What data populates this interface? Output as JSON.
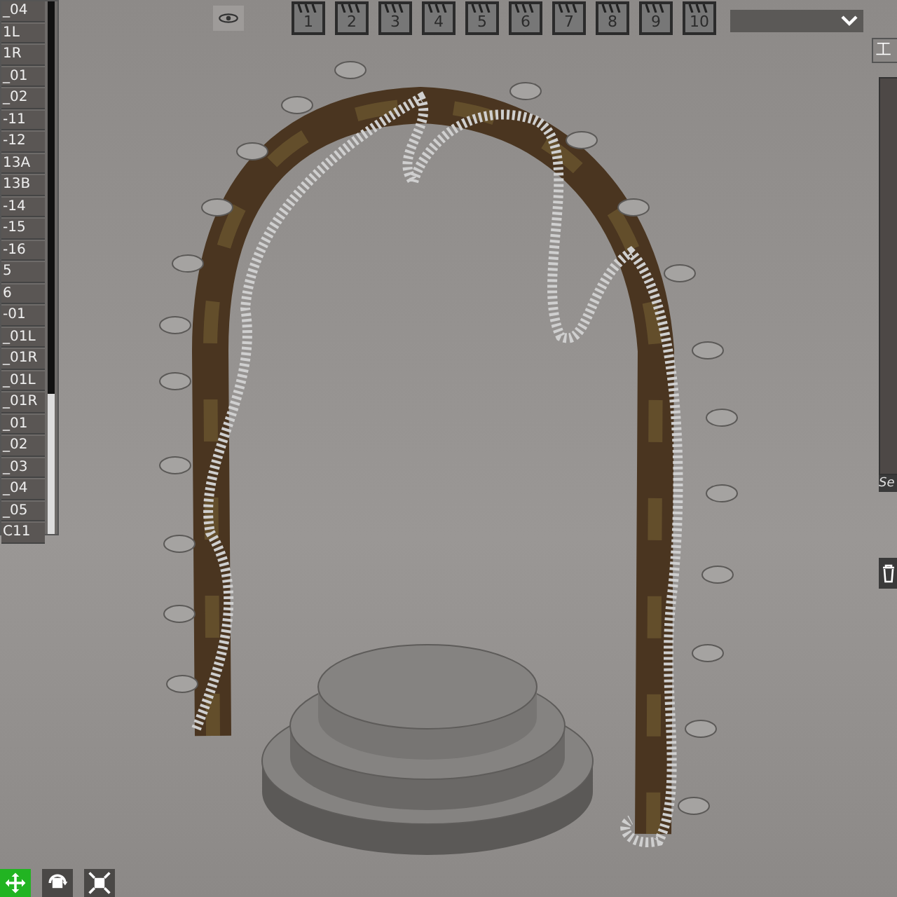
{
  "scene_list": {
    "items": [
      "_04",
      "1L",
      "1R",
      "_01",
      "_02",
      "-11",
      "-12",
      "13A",
      "13B",
      "-14",
      "-15",
      "-16",
      "5",
      "6",
      "-01",
      "_01L",
      "_01R",
      "_01L",
      "_01R",
      "_01",
      "_02",
      "_03",
      "_04",
      "_05",
      "C11"
    ]
  },
  "toolbar": {
    "camera_slots": [
      "1",
      "2",
      "3",
      "4",
      "5",
      "6",
      "7",
      "8",
      "9",
      "10"
    ]
  },
  "right_panel": {
    "tab_label": "工",
    "status_text": "Se"
  },
  "transform_tools": [
    {
      "kind": "move",
      "selected": true
    },
    {
      "kind": "rotate",
      "selected": false
    },
    {
      "kind": "scale",
      "selected": false
    }
  ]
}
